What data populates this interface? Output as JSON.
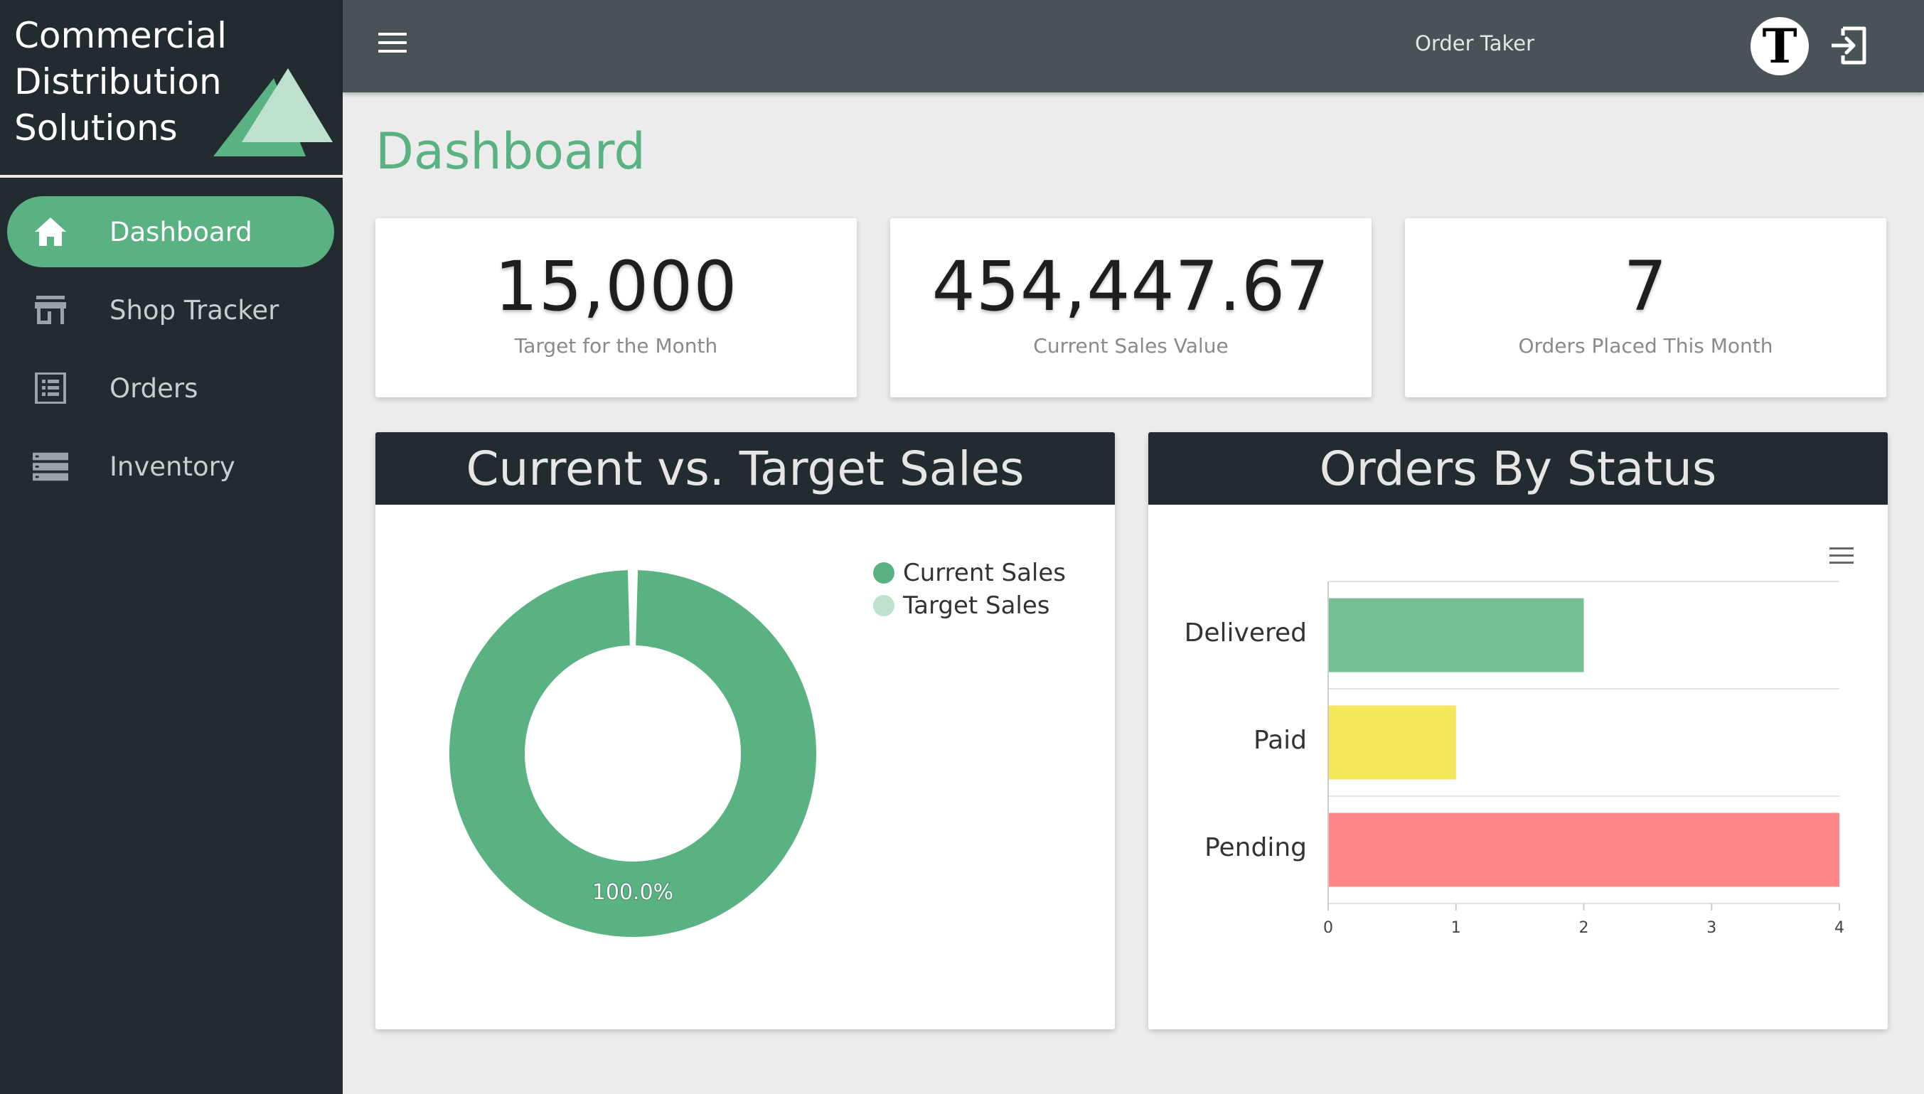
{
  "brand": {
    "name_line1": "Commercial",
    "name_line2": "Distribution",
    "name_line3": "Solutions"
  },
  "sidebar": {
    "items": [
      {
        "label": "Dashboard",
        "icon": "home-icon",
        "active": true
      },
      {
        "label": "Shop Tracker",
        "icon": "store-icon",
        "active": false
      },
      {
        "label": "Orders",
        "icon": "list-icon",
        "active": false
      },
      {
        "label": "Inventory",
        "icon": "inventory-icon",
        "active": false
      }
    ]
  },
  "header": {
    "user_role": "Order Taker",
    "avatar_letter": "T"
  },
  "page": {
    "title": "Dashboard"
  },
  "stats": [
    {
      "value": "15,000",
      "label": "Target for the Month"
    },
    {
      "value": "454,447.67",
      "label": "Current Sales Value"
    },
    {
      "value": "7",
      "label": "Orders Placed This Month"
    }
  ],
  "panels": {
    "donut_title": "Current vs. Target Sales",
    "bar_title": "Orders By Status"
  },
  "colors": {
    "accent": "#5ab283",
    "sidebar": "#212b30",
    "topbar": "#495257"
  },
  "chart_data": [
    {
      "type": "pie",
      "variant": "donut",
      "title": "Current vs. Target Sales",
      "categories": [
        "Current Sales",
        "Target Sales"
      ],
      "values": [
        100.0,
        0.0
      ],
      "colors": [
        "#5ab283",
        "#bfe0cd"
      ],
      "data_labels": [
        "100.0%"
      ],
      "legend": "top-right"
    },
    {
      "type": "bar",
      "orientation": "horizontal",
      "title": "Orders By Status",
      "categories": [
        "Delivered",
        "Paid",
        "Pending"
      ],
      "values": [
        2,
        1,
        4
      ],
      "colors": [
        "#74bf95",
        "#f5e65a",
        "#ff8787"
      ],
      "xlim": [
        0,
        4
      ],
      "xticks": [
        "0",
        "1",
        "2",
        "3",
        "4"
      ],
      "grid": true
    }
  ]
}
